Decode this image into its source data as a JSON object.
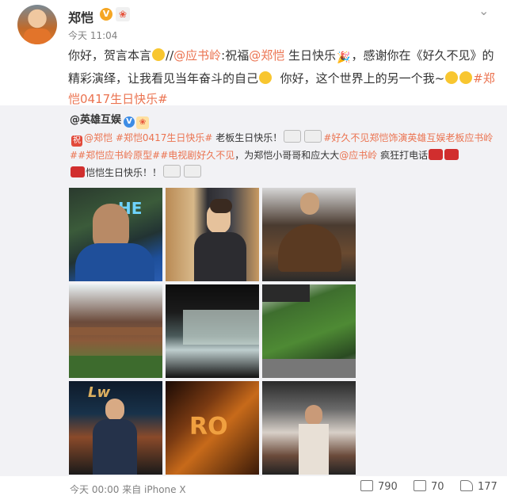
{
  "post": {
    "username": "郑恺",
    "time": "今天 11:04",
    "text_parts": {
      "p1": "你好，贺言本言",
      "p2": "//",
      "p3": "@应书岭",
      "p4": ":祝福",
      "p5": "@郑恺",
      "p6": " 生日快乐",
      "p7": "，感谢你在《好久不见》的精彩演绎，让我看见当年奋斗的自己",
      "p8": "你好，这个世界上的另一个我~",
      "p9": "#郑恺0417生日快乐#"
    }
  },
  "repost": {
    "username": "@英雄互娱",
    "text_parts": {
      "r1": "祝",
      "r2": "@郑恺",
      "r3": " #郑恺0417生日快乐#",
      "r4": " 老板生日快乐！",
      "r5": "#好久不见郑恺饰演英雄互娱老板应书岭#",
      "r6": "#郑恺应书岭原型#",
      "r7": "#电视剧好久不见",
      "r8": "，为郑恺小哥哥和应大大",
      "r9": "@应书岭",
      "r10": " 疯狂打电话",
      "r11": "恺恺生日快乐！！"
    },
    "photo_texts": {
      "p1": "HE",
      "p7": "Lw",
      "p8": "RO"
    }
  },
  "footer": {
    "time_source": "今天 00:00 来自 iPhone X",
    "reposts": "790",
    "comments": "70",
    "likes": "177"
  },
  "icons": [
    "avatar",
    "verified-v-icon",
    "level-badge-icon",
    "chevron-down-icon",
    "emoji-icon",
    "party-popper-icon",
    "blue-v-icon",
    "zhu-badge-icon",
    "cake-emoji-icon",
    "phone-emoji-icon",
    "repost-icon",
    "comment-icon",
    "like-icon"
  ],
  "colors": {
    "link": "#eb7350",
    "repost_bg": "#f2f2f5"
  }
}
